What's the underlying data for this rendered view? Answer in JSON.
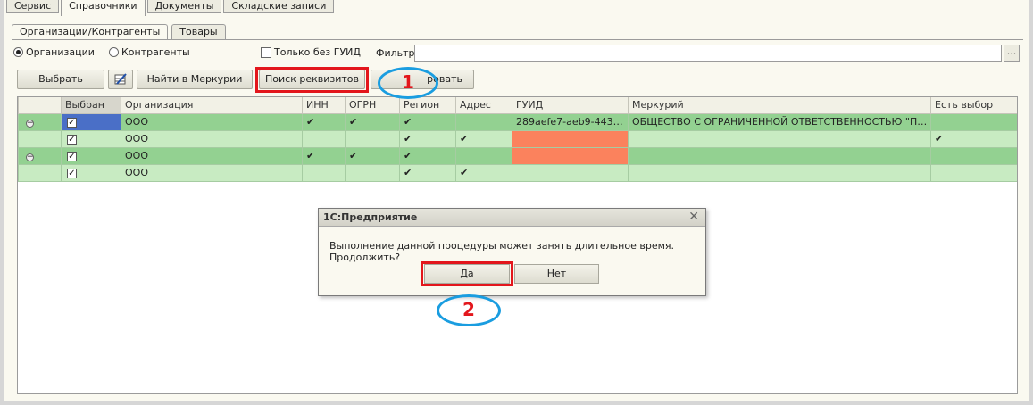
{
  "top_tabs": [
    "Сервис",
    "Справочники",
    "Документы",
    "Складские записи"
  ],
  "sub_tabs": [
    "Организации/Контрагенты",
    "Товары"
  ],
  "options": {
    "radio_org": "Организации",
    "radio_contr": "Контрагенты",
    "only_no_guid": "Только без ГУИД",
    "filter_label": "Фильтр:",
    "filter_value": "",
    "filter_button": "..."
  },
  "toolbar": {
    "select": "Выбрать",
    "find_mercury": "Найти в Меркурии",
    "search_details": "Поиск реквизитов",
    "partial_hidden": "ровать"
  },
  "table": {
    "columns": [
      "",
      "Выбран",
      "Организация",
      "ИНН",
      "ОГРН",
      "Регион",
      "Адрес",
      "ГУИД",
      "Меркурий",
      "Есть выбор"
    ],
    "rows": [
      {
        "name": "ООО",
        "guid": "289aefe7-aeb9-443e-a...",
        "mercury": "ОБЩЕСТВО С ОГРАНИЧЕННОЙ ОТВЕТСТВЕННОСТЬЮ \"ПЕР..."
      },
      {
        "name": "ООО",
        "guid": "",
        "mercury": ""
      },
      {
        "name": "ООО",
        "guid": "",
        "mercury": ""
      },
      {
        "name": "ООО",
        "guid": "",
        "mercury": ""
      }
    ]
  },
  "dialog": {
    "title": "1С:Предприятие",
    "message": "Выполнение данной процедуры может занять длительное время. Продолжить?",
    "yes": "Да",
    "no": "Нет"
  },
  "annotations": {
    "one": "1",
    "two": "2"
  },
  "colors": {
    "highlight": "#e3161c",
    "ellipse": "#1a9de0",
    "row_dark": "#93d191",
    "row_light": "#c8ebc2",
    "no_guid": "#fb825d"
  }
}
